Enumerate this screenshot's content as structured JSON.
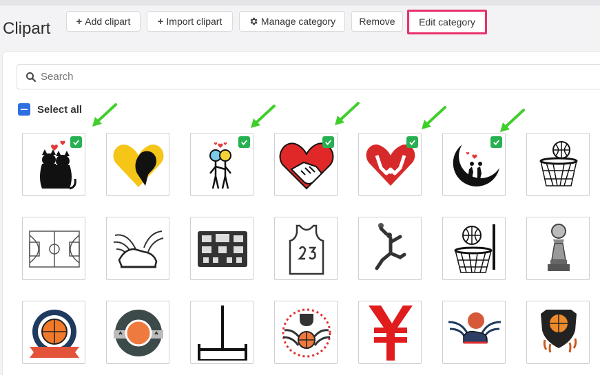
{
  "header": {
    "title": "Clipart",
    "buttons": {
      "add": "Add clipart",
      "import": "Import clipart",
      "manage": "Manage category",
      "remove": "Remove",
      "edit": "Edit category"
    }
  },
  "search": {
    "placeholder": "Search",
    "value": ""
  },
  "select_all": {
    "label": "Select all",
    "state": "indeterminate"
  },
  "accent_colors": {
    "checkbox_blue": "#2f6fe0",
    "check_green": "#27b152",
    "highlight_pink": "#e8306a",
    "arrow_green": "#3fcf2a"
  },
  "clipart_items": [
    {
      "icon": "cats-in-love-icon",
      "selected": true
    },
    {
      "icon": "heart-silhouette-icon",
      "selected": false
    },
    {
      "icon": "stick-couple-icon",
      "selected": true
    },
    {
      "icon": "handshake-heart-icon",
      "selected": true
    },
    {
      "icon": "hands-heart-icon",
      "selected": true
    },
    {
      "icon": "moon-couple-icon",
      "selected": true
    },
    {
      "icon": "basketball-hoop-icon",
      "selected": false
    },
    {
      "icon": "basketball-court-icon",
      "selected": false
    },
    {
      "icon": "winged-shoe-icon",
      "selected": false
    },
    {
      "icon": "scoreboard-icon",
      "selected": false
    },
    {
      "icon": "jersey-23-icon",
      "selected": false
    },
    {
      "icon": "dunking-player-icon",
      "selected": false
    },
    {
      "icon": "hoop-with-ball-icon",
      "selected": false
    },
    {
      "icon": "trophy-icon",
      "selected": false
    },
    {
      "icon": "basketball-badge-icon",
      "selected": false
    },
    {
      "icon": "basketball-emblem-icon",
      "selected": false
    },
    {
      "icon": "goal-post-icon",
      "selected": false
    },
    {
      "icon": "trophy-wings-emblem-icon",
      "selected": false
    },
    {
      "icon": "yen-sign-icon",
      "selected": false
    },
    {
      "icon": "winged-sneaker-icon",
      "selected": false
    },
    {
      "icon": "basketball-shield-icon",
      "selected": false
    }
  ]
}
